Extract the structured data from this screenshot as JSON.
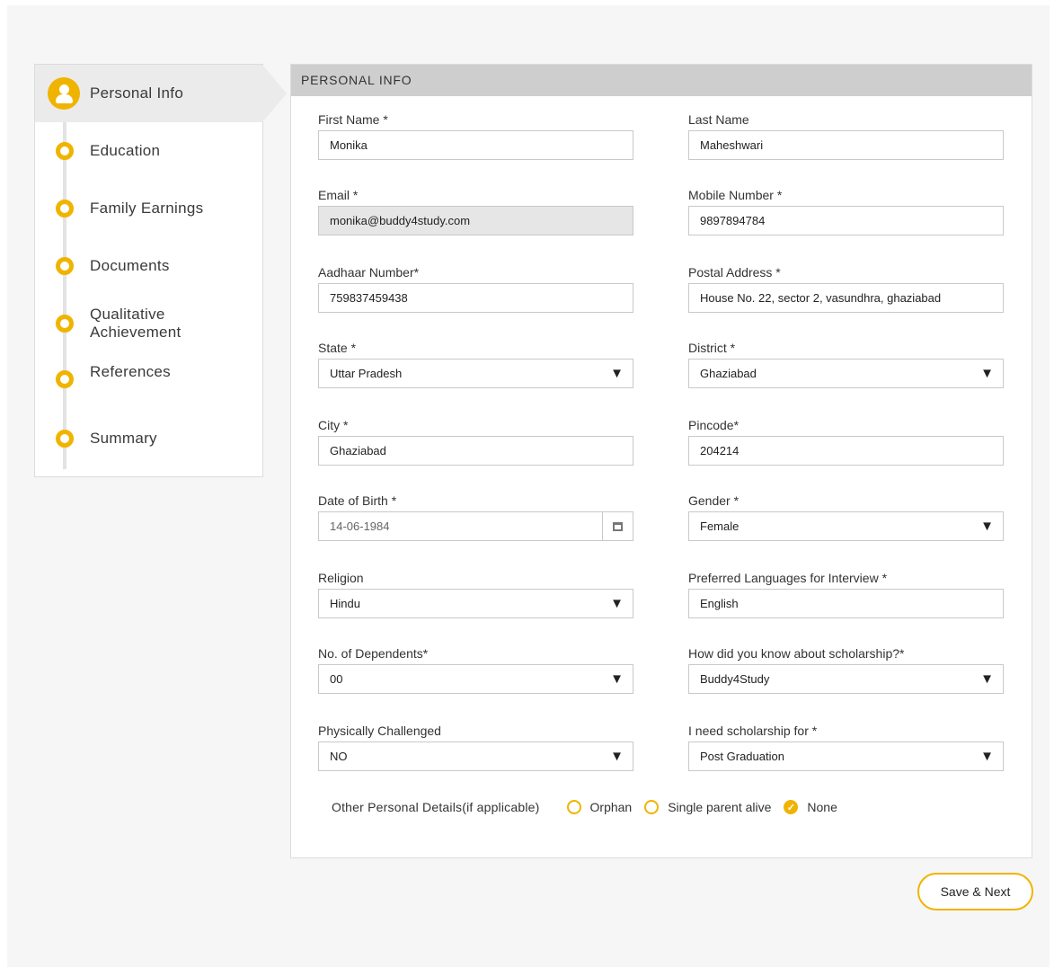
{
  "accent_color": "#f0b400",
  "steps": [
    {
      "label": "Personal Info",
      "icon": "user-icon",
      "active": true
    },
    {
      "label": "Education",
      "icon": "step-dot-icon"
    },
    {
      "label": "Family Earnings",
      "icon": "step-dot-icon"
    },
    {
      "label": "Documents",
      "icon": "step-dot-icon"
    },
    {
      "label": "Qualitative Achievement",
      "icon": "step-dot-icon"
    },
    {
      "label": "References",
      "icon": "step-dot-icon"
    },
    {
      "label": "Summary",
      "icon": "step-dot-icon"
    }
  ],
  "panel": {
    "title": "PERSONAL INFO"
  },
  "fields": {
    "first_name": {
      "label": "First Name *",
      "value": "Monika"
    },
    "last_name": {
      "label": "Last Name",
      "value": "Maheshwari"
    },
    "email": {
      "label": "Email *",
      "value": "monika@buddy4study.com"
    },
    "mobile": {
      "label": "Mobile Number *",
      "value": "9897894784"
    },
    "aadhaar": {
      "label": "Aadhaar Number*",
      "value": "759837459438"
    },
    "postal": {
      "label": "Postal Address *",
      "value": "House No. 22, sector 2, vasundhra, ghaziabad"
    },
    "state": {
      "label": "State *",
      "value": "Uttar Pradesh"
    },
    "district": {
      "label": "District *",
      "value": "Ghaziabad"
    },
    "city": {
      "label": "City *",
      "value": "Ghaziabad"
    },
    "pincode": {
      "label": "Pincode*",
      "value": "204214"
    },
    "dob": {
      "label": "Date of Birth *",
      "value": "14-06-1984"
    },
    "gender": {
      "label": "Gender *",
      "value": "Female"
    },
    "religion": {
      "label": "Religion",
      "value": "Hindu"
    },
    "languages": {
      "label": "Preferred Languages for Interview *",
      "value": "English"
    },
    "dependents": {
      "label": "No. of Dependents*",
      "value": "00"
    },
    "source": {
      "label": "How did you know about scholarship?*",
      "value": "Buddy4Study"
    },
    "physically": {
      "label": "Physically Challenged",
      "value": "NO"
    },
    "scholarship_for": {
      "label": "I need scholarship for *",
      "value": "Post Graduation"
    }
  },
  "other_details": {
    "label": "Other Personal Details(if applicable)",
    "options": [
      {
        "label": "Orphan",
        "checked": false
      },
      {
        "label": "Single parent alive",
        "checked": false
      },
      {
        "label": "None",
        "checked": true
      }
    ]
  },
  "save_label": "Save & Next",
  "dropdown_icon": "caret-down-icon",
  "calendar_icon": "calendar-icon"
}
